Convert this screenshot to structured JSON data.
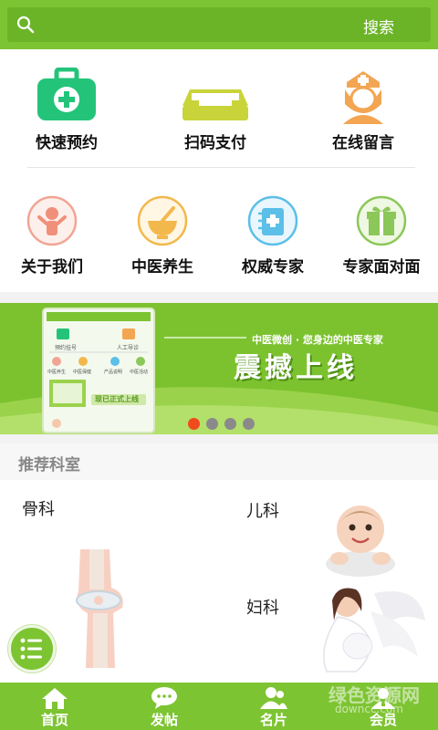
{
  "colors": {
    "brand": "#7dc432",
    "search_bg": "#6cb427",
    "dot_active": "#f04a1d"
  },
  "search": {
    "label": "搜索",
    "icon": "search-icon"
  },
  "grid": {
    "row1": [
      {
        "label": "快速预约",
        "icon": "medical-kit-icon"
      },
      {
        "label": "扫码支付",
        "icon": "tray-icon"
      },
      {
        "label": "在线留言",
        "icon": "nurse-icon"
      }
    ],
    "row2": [
      {
        "label": "关于我们",
        "icon": "person-icon"
      },
      {
        "label": "中医养生",
        "icon": "mortar-bowl-icon"
      },
      {
        "label": "权威专家",
        "icon": "expert-book-icon"
      },
      {
        "label": "专家面对面",
        "icon": "gift-icon"
      }
    ]
  },
  "banner": {
    "tagline": "中医微创 · 您身边的中医专家",
    "headline": "震撼上线",
    "phone_items": [
      "预约挂号",
      "人工导诊",
      "中医养生",
      "中医保健",
      "产品说明",
      "中医活动"
    ],
    "phone_promo": "现已正式上线",
    "dots": 4,
    "active_dot": 0
  },
  "recommend": {
    "title": "推荐科室",
    "departments": [
      "骨科",
      "儿科",
      "妇科"
    ]
  },
  "nav": {
    "items": [
      {
        "label": "首页",
        "icon": "home-icon"
      },
      {
        "label": "发帖",
        "icon": "chat-bubble-icon"
      },
      {
        "label": "名片",
        "icon": "contacts-icon"
      },
      {
        "label": "会员",
        "icon": "member-icon"
      }
    ]
  },
  "watermark": {
    "main": "绿色资源网",
    "sub": "downcc.com"
  }
}
